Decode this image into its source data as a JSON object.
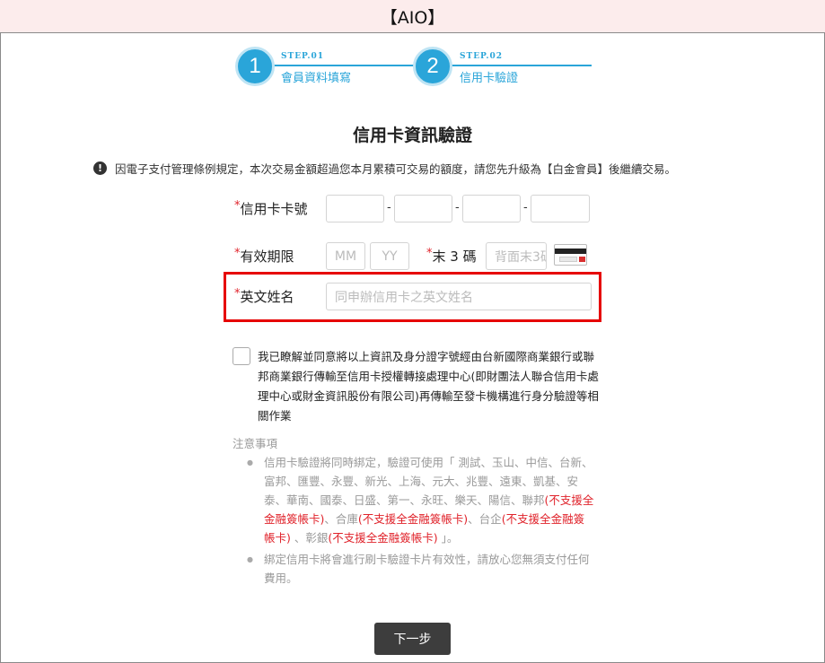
{
  "banner": {
    "title": "【AIO】"
  },
  "steps": [
    {
      "number": "1",
      "tag": "STEP.01",
      "name": "會員資料填寫"
    },
    {
      "number": "2",
      "tag": "STEP.02",
      "name": "信用卡驗證"
    }
  ],
  "page_title": "信用卡資訊驗證",
  "notice": {
    "icon": "exclamation-icon",
    "text": "因電子支付管理條例規定，本次交易金額超過您本月累積可交易的額度，請您先升級為【白金會員】後繼續交易。"
  },
  "form": {
    "required_mark": "*",
    "card_number_label": "信用卡卡號",
    "dash": "-",
    "expiry_label": "有效期限",
    "month_placeholder": "MM",
    "year_placeholder": "YY",
    "cvv_label": "末 3 碼",
    "cvv_placeholder": "背面末3碼",
    "name_label": "英文姓名",
    "name_placeholder": "同申辦信用卡之英文姓名"
  },
  "consent": {
    "text": "我已瞭解並同意將以上資訊及身分證字號經由台新國際商業銀行或聯邦商業銀行傳輸至信用卡授權轉接處理中心(即財團法人聯合信用卡處理中心或財金資訊股份有限公司)再傳輸至發卡機構進行身分驗證等相關作業"
  },
  "notes": {
    "title": "注意事項",
    "item1_part1": "信用卡驗證將同時綁定，驗證可使用「 測試、玉山、中信、台新、富邦、匯豐、永豐、新光、上海、元大、兆豐、遠東、凱基、安泰、華南、國泰、日盛、第一、永旺、樂天、陽信、聯邦",
    "item1_red1": "(不支援全金融簽帳卡)",
    "item1_part2": "、合庫",
    "item1_red2": "(不支援全金融簽帳卡)",
    "item1_part3": "、台企",
    "item1_red3": "(不支援全金融簽帳卡)",
    "item1_part4": " 、彰銀",
    "item1_red4": "(不支援全金融簽帳卡)",
    "item1_part5": " 」。",
    "item2": "綁定信用卡將會進行刷卡驗證卡片有效性，請放心您無須支付任何費用。"
  },
  "next_button": "下一步",
  "colors": {
    "accent": "#2aa5d9",
    "required": "#e0232b",
    "highlight": "#e60000",
    "button": "#3d3d3d",
    "banner_bg": "#fcecec"
  }
}
